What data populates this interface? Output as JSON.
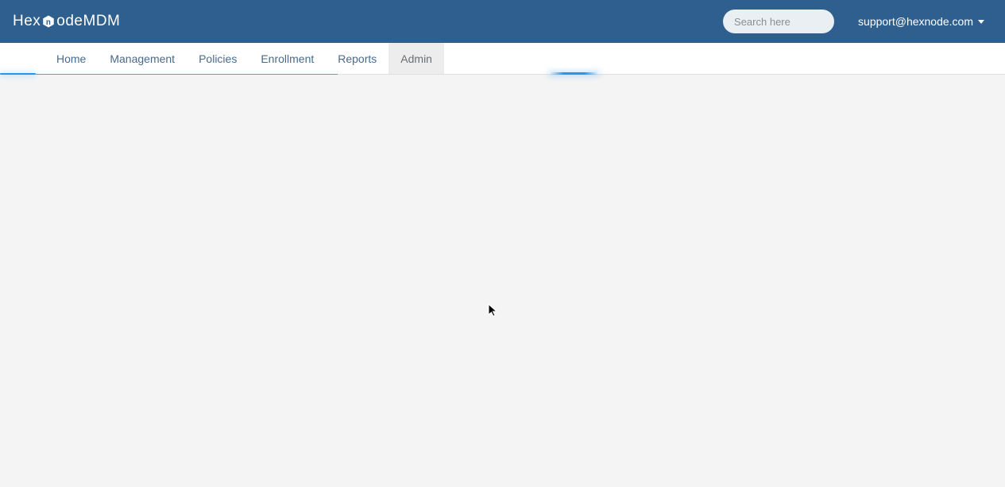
{
  "header": {
    "brand_prefix": "Hex",
    "brand_mid": "n",
    "brand_suffix": "ode",
    "brand_product": " MDM",
    "search_placeholder": "Search here",
    "user_email": "support@hexnode.com"
  },
  "nav": {
    "items": [
      {
        "label": "Home",
        "active": false
      },
      {
        "label": "Management",
        "active": false
      },
      {
        "label": "Policies",
        "active": false
      },
      {
        "label": "Enrollment",
        "active": false
      },
      {
        "label": "Reports",
        "active": false
      },
      {
        "label": "Admin",
        "active": true
      }
    ]
  }
}
